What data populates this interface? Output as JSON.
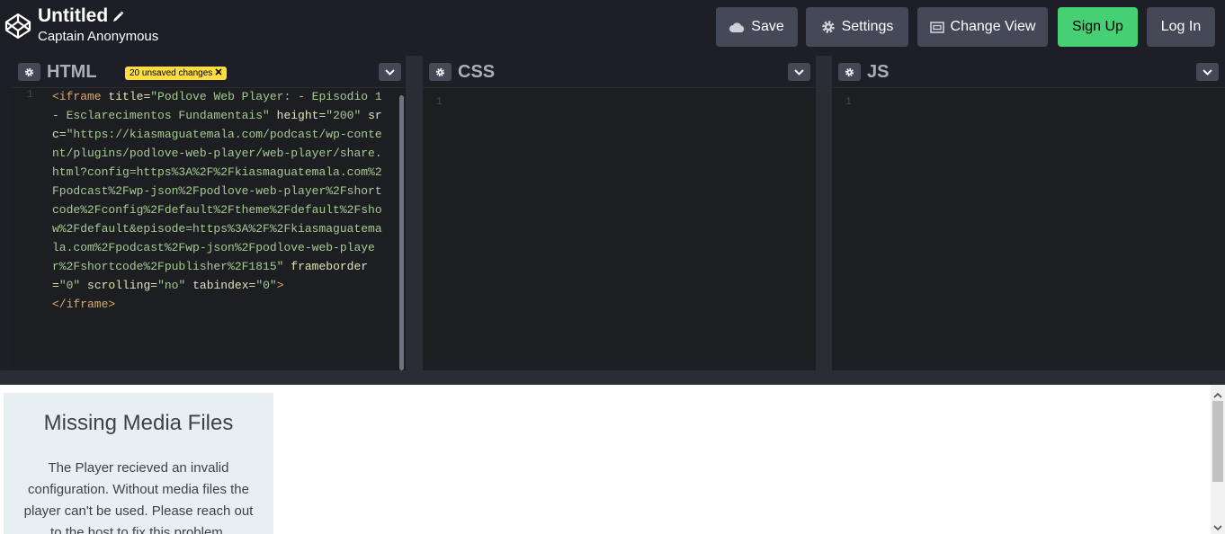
{
  "header": {
    "title": "Untitled",
    "subtitle": "Captain Anonymous",
    "buttons": {
      "save": "Save",
      "settings": "Settings",
      "change_view": "Change View",
      "sign_up": "Sign Up",
      "log_in": "Log In"
    }
  },
  "editors": {
    "html": {
      "title": "HTML",
      "badge": "20 unsaved changes",
      "line_numbers": [
        "1"
      ],
      "code": {
        "open_tag": "<iframe",
        "attr_title": "title",
        "val_title": "\"Podlove Web Player: - Episodio 1 - Esclarecimentos Fundamentais\"",
        "attr_height": "height",
        "val_height": "\"200\"",
        "attr_src": "src",
        "val_src": "\"https://kiasmaguatemala.com/podcast/wp-content/plugins/podlove-web-player/web-player/share.html?config=https%3A%2F%2Fkiasmaguatemala.com%2Fpodcast%2Fwp-json%2Fpodlove-web-player%2Fshortcode%2Fconfig%2Fdefault%2Ftheme%2Fdefault%2Fshow%2Fdefault&episode=https%3A%2F%2Fkiasmaguatemala.com%2Fpodcast%2Fwp-json%2Fpodlove-web-player%2Fshortcode%2Fpublisher%2F1815\"",
        "attr_frameborder": "frameborder",
        "val_frameborder": "\"0\"",
        "attr_scrolling": "scrolling",
        "val_scrolling": "\"no\"",
        "attr_tabindex": "tabindex",
        "val_tabindex": "\"0\"",
        "open_close": ">",
        "close_tag": "</iframe>"
      }
    },
    "css": {
      "title": "CSS",
      "line_numbers": [
        "1"
      ]
    },
    "js": {
      "title": "JS",
      "line_numbers": [
        "1"
      ]
    }
  },
  "preview": {
    "card_title": "Missing Media Files",
    "card_text": "The Player recieved an invalid configuration. Without media files the player can't be used. Please reach out to the host to fix this problem."
  },
  "colors": {
    "background": "#1e1f26",
    "button": "#444857",
    "sign_up": "#47cf73",
    "badge": "#ffdd40"
  }
}
